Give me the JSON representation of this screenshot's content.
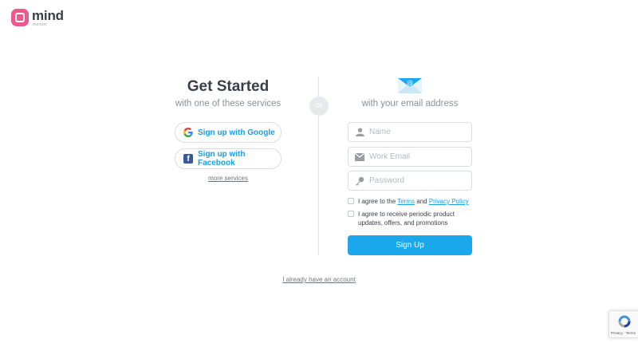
{
  "logo": {
    "name": "mind",
    "sub": "meister"
  },
  "left": {
    "title": "Get Started",
    "subtitle": "with one of these services",
    "google_label": "Sign up with Google",
    "facebook_label": "Sign up with Facebook",
    "more_services": "more services"
  },
  "divider": {
    "or": "or"
  },
  "right": {
    "subtitle": "with your email address",
    "name_placeholder": "Name",
    "email_placeholder": "Work Email",
    "password_placeholder": "Password",
    "terms_prefix": "I agree to the",
    "terms_link": "Terms",
    "terms_and": "and",
    "privacy_link": "Privacy Policy",
    "updates_text": "I agree to receive periodic product updates, offers, and promotions",
    "signup_label": "Sign Up"
  },
  "footer": {
    "have_account": "I already have an account"
  },
  "recaptcha": {
    "text": "Privacy - Terms"
  },
  "colors": {
    "accent": "#1aa7ec",
    "brand": "#f0578a",
    "facebook": "#3b5998"
  },
  "icons": [
    "mind-logo-icon",
    "google-icon",
    "facebook-icon",
    "envelope-icon",
    "user-icon",
    "mail-icon",
    "key-icon",
    "recaptcha-icon"
  ]
}
